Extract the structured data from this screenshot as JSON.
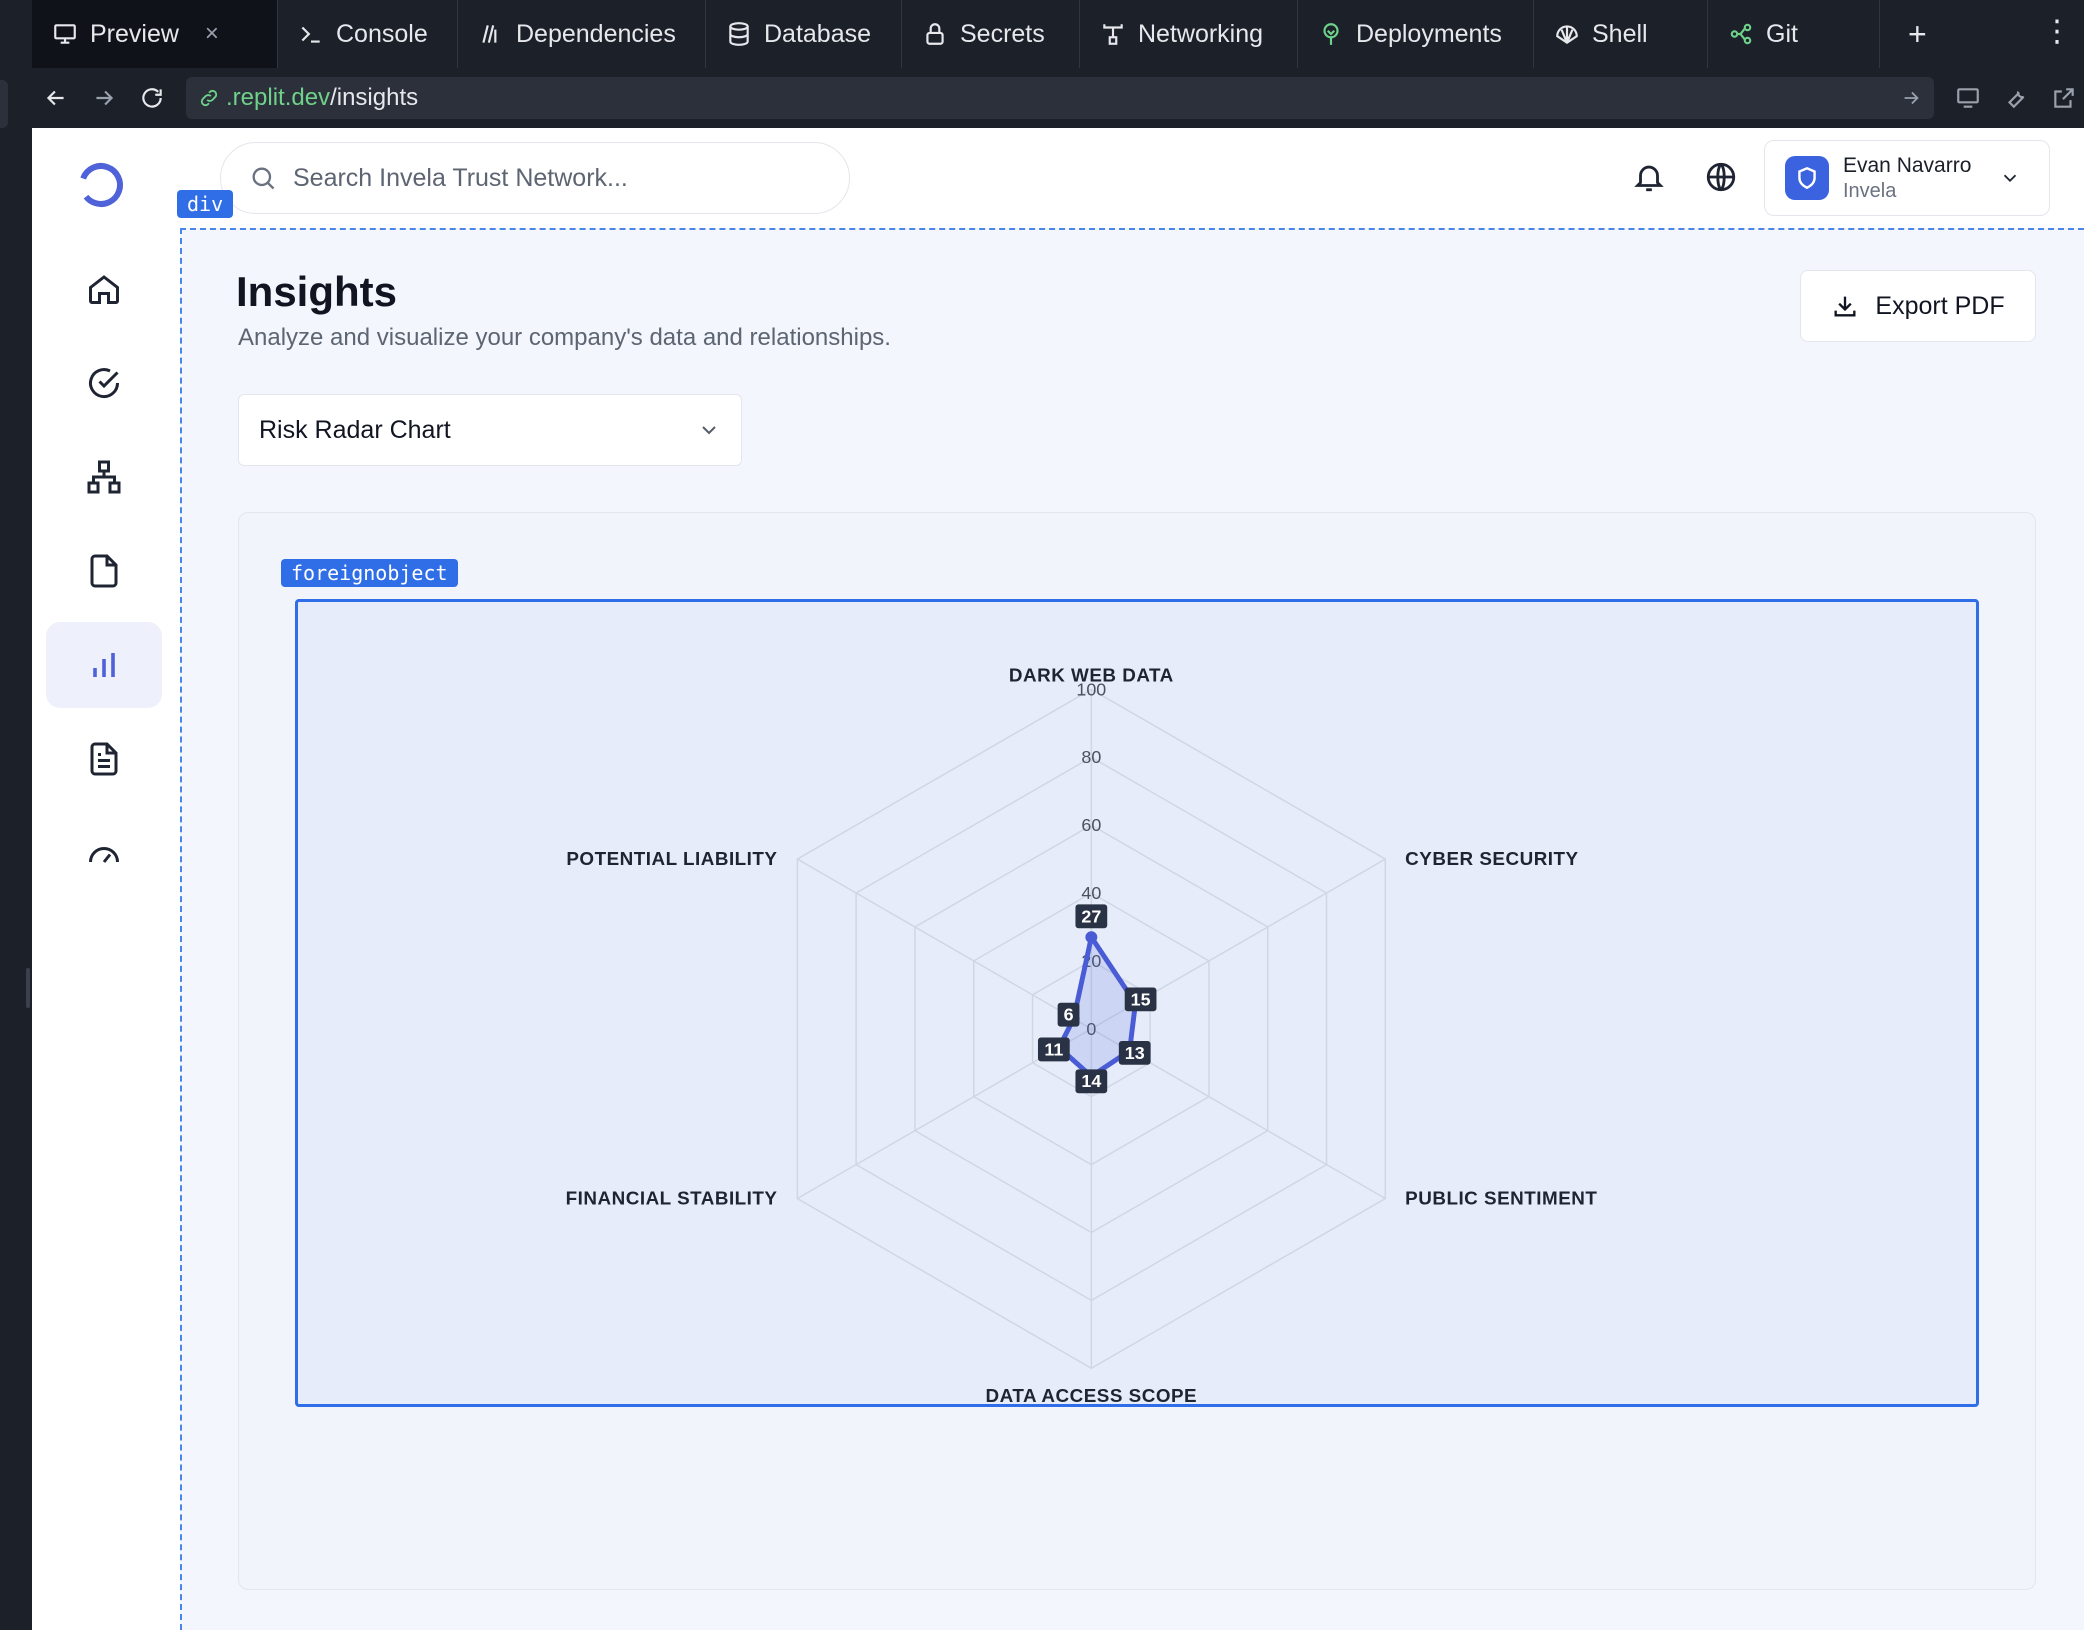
{
  "ide": {
    "tabs": [
      {
        "label": "Preview",
        "icon": "monitor-icon"
      },
      {
        "label": "Console",
        "icon": "terminal-icon"
      },
      {
        "label": "Dependencies",
        "icon": "dependencies-icon"
      },
      {
        "label": "Database",
        "icon": "database-icon"
      },
      {
        "label": "Secrets",
        "icon": "lock-icon"
      },
      {
        "label": "Networking",
        "icon": "networking-icon"
      },
      {
        "label": "Deployments",
        "icon": "deployments-icon"
      },
      {
        "label": "Shell",
        "icon": "shell-icon"
      },
      {
        "label": "Git",
        "icon": "git-icon"
      }
    ],
    "close_glyph": "×",
    "add_glyph": "+",
    "more_glyph": "⋮",
    "url": {
      "host": ".replit.dev",
      "path": "/insights"
    }
  },
  "app": {
    "search_placeholder": "Search Invela Trust Network...",
    "user": {
      "name": "Evan Navarro",
      "org": "Invela"
    },
    "sidebar_icons": [
      "home-icon",
      "check-circle-icon",
      "network-icon",
      "file-icon",
      "bar-chart-icon",
      "document-icon",
      "gauge-icon"
    ],
    "active_nav": "bar-chart-icon",
    "dev_tags": {
      "div": "div",
      "foreignobject": "foreignobject"
    },
    "page": {
      "title": "Insights",
      "subtitle": "Analyze and visualize your company's data and relationships.",
      "export_label": "Export PDF",
      "chart_select": "Risk Radar Chart"
    }
  },
  "colors": {
    "accent": "#4f62d8",
    "series": "#4a5bd6",
    "label_bg": "#2a3346",
    "grid": "#cfd7e6"
  },
  "chart_data": {
    "type": "radar",
    "categories": [
      "DARK WEB DATA",
      "CYBER SECURITY",
      "PUBLIC SENTIMENT",
      "DATA ACCESS SCOPE",
      "FINANCIAL STABILITY",
      "POTENTIAL LIABILITY"
    ],
    "values": [
      27,
      15,
      13,
      14,
      11,
      6
    ],
    "ticks": [
      0,
      20,
      40,
      60,
      80,
      100
    ],
    "range": [
      0,
      100
    ]
  }
}
